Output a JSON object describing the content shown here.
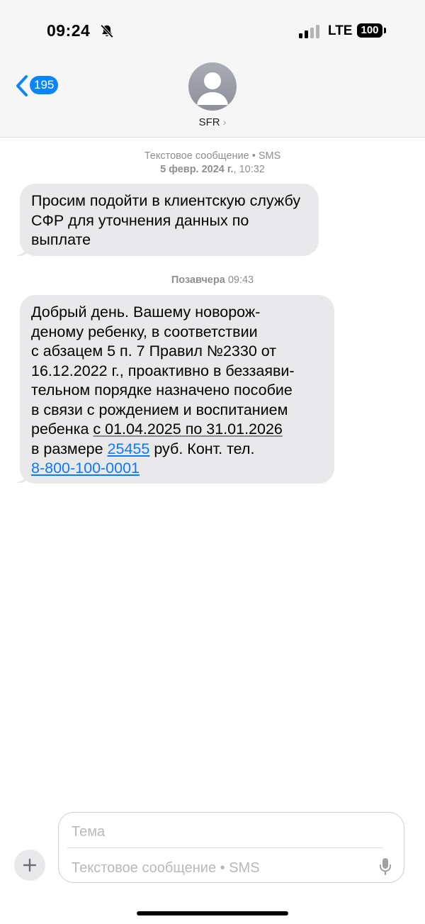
{
  "status_bar": {
    "time": "09:24",
    "silent_icon": "bell-slash-icon",
    "signal_icon": "cellular-signal-icon",
    "network": "LTE",
    "battery": "100"
  },
  "nav": {
    "back_icon": "chevron-left-icon",
    "unread_count": "195",
    "contact_name": "SFR",
    "contact_chevron": "›",
    "avatar_icon": "person-icon"
  },
  "thread": [
    {
      "meta_line1": "Текстовое сообщение • SMS",
      "meta_line2_date": "5 февр. 2024 г.",
      "meta_line2_time": ", 10:32",
      "text": "Просим подойти в клиентскую службу СФР для уточнения данных по выплате"
    },
    {
      "meta_line1": "Позавчера",
      "meta_line1_time": " 09:43",
      "line1": "Добрый день. Вашему новорож-",
      "line2": "деному ребенку, в соответствии",
      "line3": "с абзацем 5 п. 7 Правил №2330 от",
      "line4": "16.12.2022 г., проактивно в беззаяви-",
      "line5": "тельном порядке назначено пособие",
      "line6": "в связи с рождением и воспитанием",
      "line7_a": "ребенка ",
      "line7_period": "с 01.04.2025 по 31.01.2026",
      "line8_a": "в размере ",
      "amount": "25455",
      "line8_b": " руб. Конт. тел.",
      "phone": "8-800-100-0001"
    }
  ],
  "composer": {
    "plus_icon": "plus-icon",
    "subject_placeholder": "Тема",
    "message_placeholder": "Текстовое сообщение • SMS",
    "mic_icon": "microphone-icon"
  },
  "colors": {
    "accent": "#0a84ff",
    "bubble_incoming": "#e9e9eb",
    "header_bg": "#f6f6f6",
    "meta_text": "#8e8e93"
  }
}
